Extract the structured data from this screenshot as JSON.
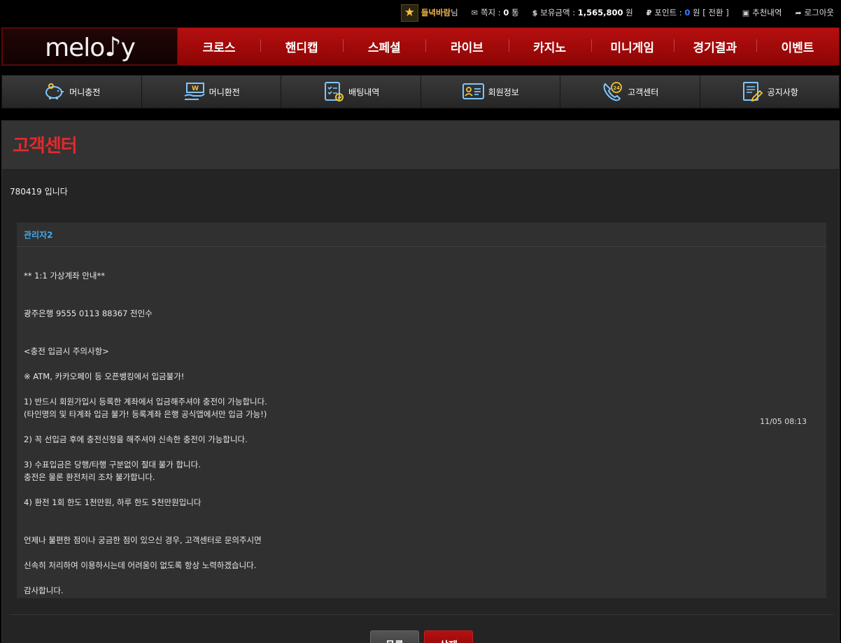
{
  "topbar": {
    "username": "들녁바람",
    "username_suffix": "님",
    "messages_label": "쪽지 :",
    "messages_count": "0",
    "messages_unit": "통",
    "balance_label": "보유금액 :",
    "balance_value": "1,565,800",
    "balance_unit": "원",
    "points_label": "포인트 :",
    "points_value": "0",
    "points_unit": "원",
    "convert_label": "[ 전환 ]",
    "recommend_label": "추천내역",
    "logout_label": "로그아웃"
  },
  "logo": {
    "text": "melo",
    "tail": "y"
  },
  "main_nav": [
    {
      "label": "크로스"
    },
    {
      "label": "핸디캡"
    },
    {
      "label": "스페셜"
    },
    {
      "label": "라이브"
    },
    {
      "label": "카지노"
    },
    {
      "label": "미니게임"
    },
    {
      "label": "경기결과"
    },
    {
      "label": "이벤트"
    }
  ],
  "sub_nav": [
    {
      "label": "머니충전",
      "icon": "piggy-bank-icon"
    },
    {
      "label": "머니환전",
      "icon": "money-exchange-icon"
    },
    {
      "label": "배팅내역",
      "icon": "checklist-icon"
    },
    {
      "label": "회원정보",
      "icon": "id-card-icon"
    },
    {
      "label": "고객센터",
      "icon": "phone-24-icon"
    },
    {
      "label": "공지사항",
      "icon": "notice-icon"
    }
  ],
  "panel": {
    "title": "고객센터",
    "subject": "780419 입니다",
    "reply": {
      "author": "관리자2",
      "date": "11/05 08:13",
      "lines": [
        "** 1:1 가상계좌 안내**",
        "광주은행 9555 0113 88367 전인수",
        "<충전 입금시 주의사항>",
        "※ ATM, 카카오페이 등 오픈뱅킹에서 입금불가!",
        "1) 반드시 회원가입시 등록한 계좌에서 입금해주셔야 충전이 가능합니다.",
        "(타인명의 및 타계좌 입금 불가! 등록계좌 은행 공식앱에서만 입금 가능!)",
        "2) 꼭 선입금 후에 충전신청을 해주셔야 신속한 충전이 가능합니다.",
        "3) 수표입금은 당행/타행 구분없이 절대 불가 합니다.",
        "충전은 물론 환전처리 조차 불가합니다.",
        "4) 환전 1회 한도 1천만원, 하루 한도 5천만원입니다",
        "언제나 불편한 점이나 궁금한 점이 있으신 경우, 고객센터로 문의주시면",
        "신속히 처리하여 이용하시는데 어려움이 없도록 항상 노력하겠습니다.",
        "감사합니다."
      ]
    },
    "buttons": {
      "list": "목록",
      "delete": "삭제"
    }
  },
  "colors": {
    "accent_red": "#e3292b",
    "nav_red": "#b50f0f",
    "author_blue": "#3fa9e8",
    "username_gold": "#f3b84a"
  }
}
